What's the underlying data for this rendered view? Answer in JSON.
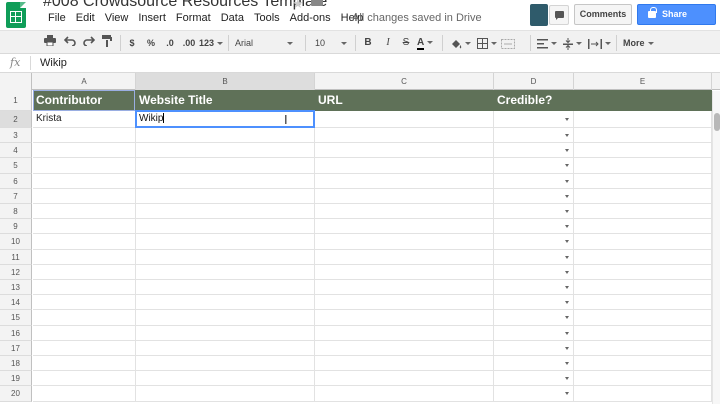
{
  "app": {
    "doc_title": "#008 Crowdsource Resources Template",
    "save_status": "All changes saved in Drive",
    "comments_label": "Comments",
    "share_label": "Share"
  },
  "menu": [
    "File",
    "Edit",
    "View",
    "Insert",
    "Format",
    "Data",
    "Tools",
    "Add-ons",
    "Help"
  ],
  "toolbar": {
    "currency": "$",
    "percent": "%",
    "decrease_decimals": ".0",
    "increase_decimals": ".00",
    "more_formats": "123",
    "font": "Arial",
    "font_size": "10",
    "bold": "B",
    "italic": "I",
    "strikethrough": "S",
    "text_color": "A",
    "more": "More"
  },
  "formula_bar": {
    "fx_label": "fx",
    "value": "Wikip"
  },
  "columns": [
    "A",
    "B",
    "C",
    "D",
    "E"
  ],
  "rows": [
    "1",
    "2",
    "3",
    "4",
    "5",
    "6",
    "7",
    "8",
    "9",
    "10",
    "11",
    "12",
    "13",
    "14",
    "15",
    "16",
    "17",
    "18",
    "19",
    "20"
  ],
  "header_row": {
    "contributor": "Contributor",
    "website_title": "Website Title",
    "url": "URL",
    "credible": "Credible?"
  },
  "row2": {
    "contributor": "Krista",
    "website_title": "Wikip"
  },
  "colors": {
    "header_fill": "#5f7158",
    "accent_blue": "#4d90fe",
    "logo_green": "#0f9d58"
  }
}
